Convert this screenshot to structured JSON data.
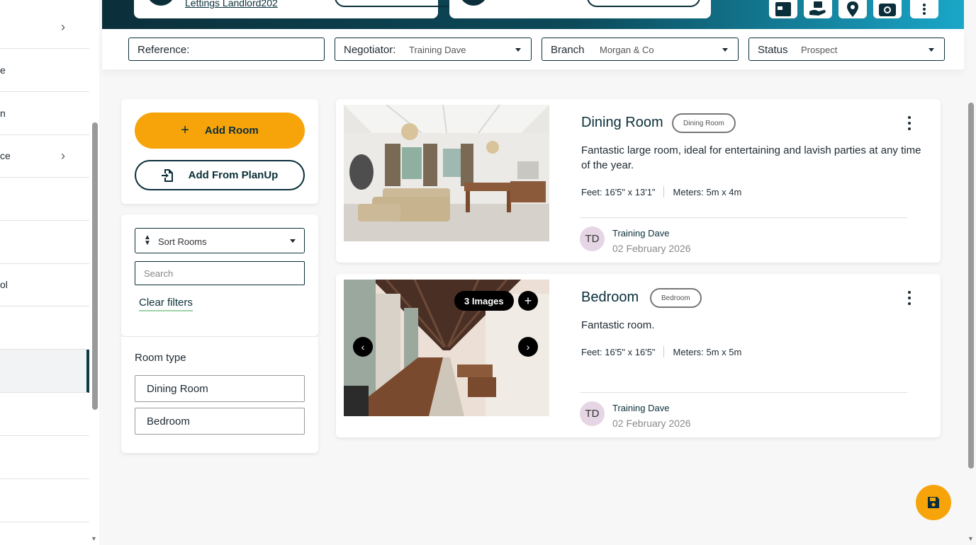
{
  "header": {
    "landlord_link": "Lettings Landlord202"
  },
  "sidebar": {
    "items": [
      {
        "label": "",
        "chevron": true
      },
      {
        "label": "e",
        "chevron": false
      },
      {
        "label": "n",
        "chevron": false
      },
      {
        "label": "ce",
        "chevron": true
      },
      {
        "label": "",
        "chevron": false
      },
      {
        "label": "",
        "chevron": false
      },
      {
        "label": "ol",
        "chevron": false
      },
      {
        "label": "",
        "chevron": false
      },
      {
        "label": "",
        "chevron": false,
        "active": true
      },
      {
        "label": "",
        "chevron": false
      },
      {
        "label": "",
        "chevron": false
      },
      {
        "label": "",
        "chevron": false
      }
    ]
  },
  "filters": {
    "reference_label": "Reference:",
    "negotiator_label": "Negotiator:",
    "negotiator_value": "Training Dave",
    "branch_label": "Branch",
    "branch_value": "Morgan & Co",
    "status_label": "Status",
    "status_value": "Prospect"
  },
  "actions": {
    "add_room": "Add Room",
    "add_from_planup": "Add From PlanUp"
  },
  "sort": {
    "label": "Sort Rooms",
    "search_placeholder": "Search",
    "clear_filters": "Clear filters"
  },
  "room_type": {
    "title": "Room type",
    "options": [
      "Dining Room",
      "Bedroom"
    ]
  },
  "rooms": [
    {
      "name": "Dining Room",
      "tag": "Dining Room",
      "description": "Fantastic large room, ideal for entertaining and lavish parties at any time of the year.",
      "feet": "Feet: 16'5\" x 13'1\"",
      "meters": "Meters: 5m x 4m",
      "author_initials": "TD",
      "author": "Training Dave",
      "date": "02 February 2026"
    },
    {
      "name": "Bedroom",
      "tag": "Bedroom",
      "description": "Fantastic room.",
      "feet": "Feet: 16'5\" x 16'5\"",
      "meters": "Meters: 5m x 5m",
      "author_initials": "TD",
      "author": "Training Dave",
      "date": "02 February 2026",
      "images_badge": "3 Images"
    }
  ],
  "colors": {
    "brand_dark": "#0b2f3a",
    "accent_orange": "#f7a40a",
    "avatar_bg": "#e6d5e4"
  }
}
